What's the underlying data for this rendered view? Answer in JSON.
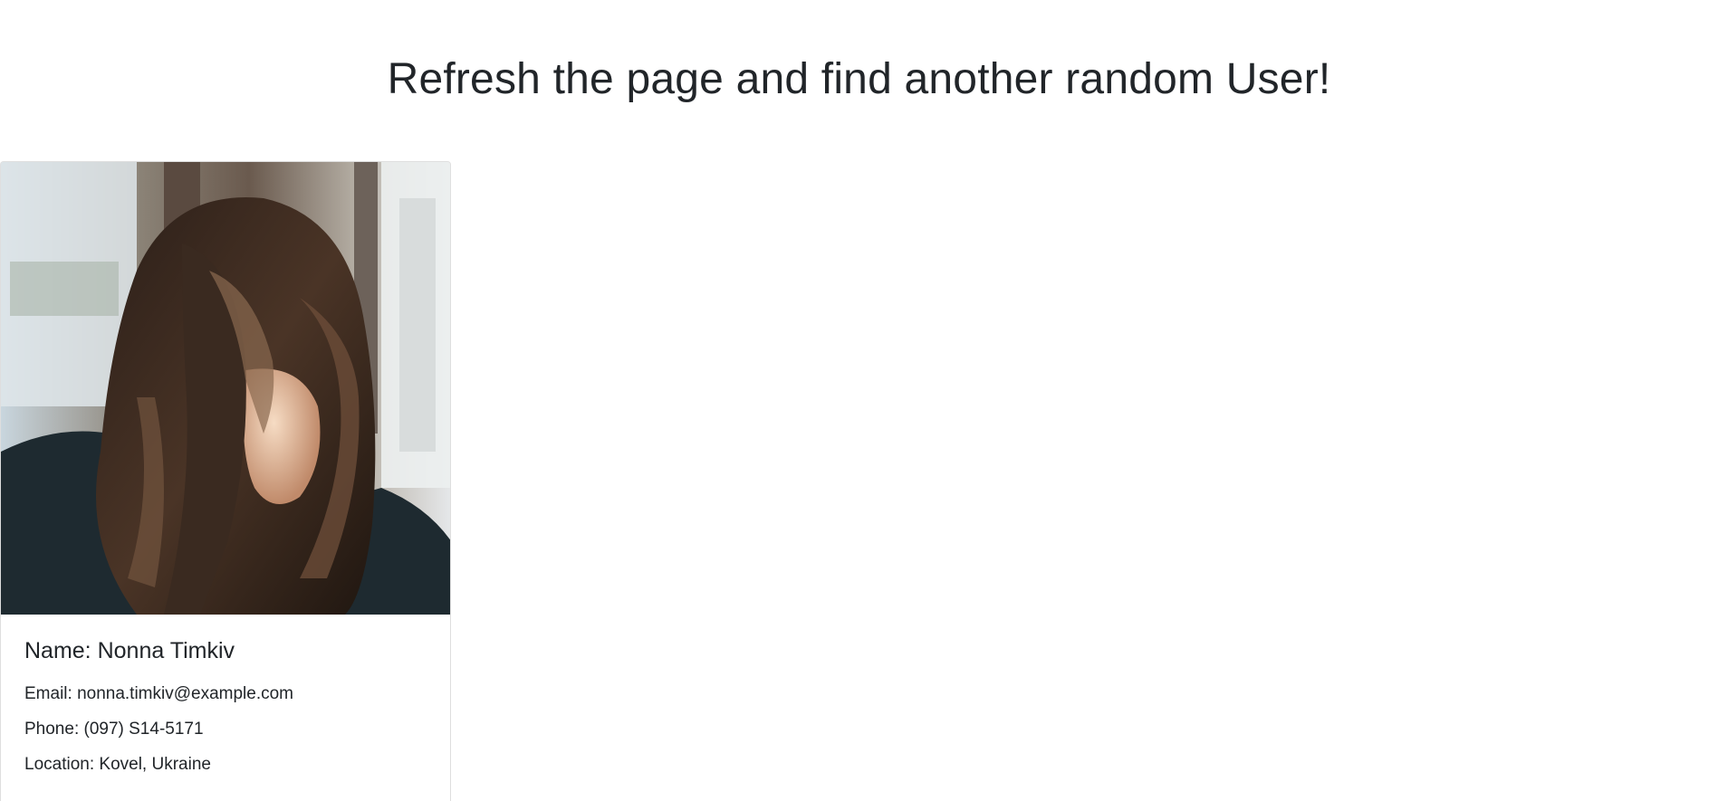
{
  "header": {
    "title": "Refresh the page and find another random User!"
  },
  "user": {
    "name": "Name: Nonna Timkiv",
    "email": "Email: nonna.timkiv@example.com",
    "phone": "Phone: (097) S14-5171",
    "location": "Location: Kovel, Ukraine"
  },
  "colors": {
    "text": "#212529",
    "card_border": "#dfdfdf",
    "background": "#ffffff"
  }
}
